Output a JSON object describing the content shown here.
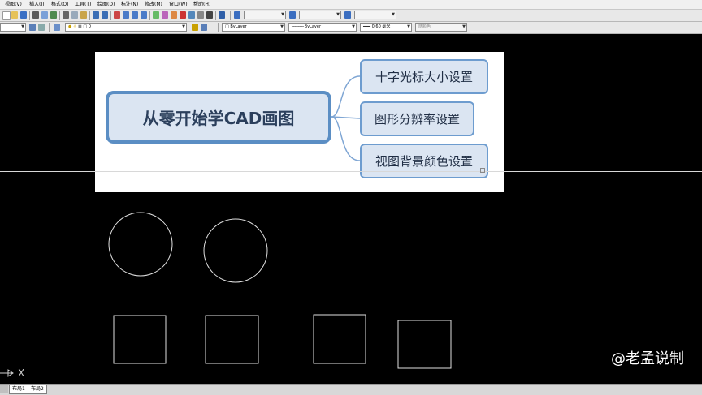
{
  "menubar": {
    "items": [
      "视图(V)",
      "插入(I)",
      "格式(O)",
      "工具(T)",
      "绘图(D)",
      "标注(N)",
      "修改(M)",
      "窗口(W)",
      "帮助(H)"
    ]
  },
  "toolbar": {
    "layer_value": "0",
    "color_value": "ByLayer",
    "linetype_value": "ByLayer",
    "lineweight_value": "0.60 毫米",
    "plotstyle_value": "随颜色"
  },
  "mindmap": {
    "central": "从零开始学CAD画图",
    "branches": [
      "十字光标大小设置",
      "图形分辨率设置",
      "视图背景颜色设置"
    ],
    "colors": {
      "fill": "#dbe5f2",
      "border": "#5b8ec4",
      "connector": "#7fa6d4"
    }
  },
  "canvas": {
    "background": "#000000",
    "crosshair_color": "#d8d8d8",
    "ucs_label": "X"
  },
  "tabs": [
    "布局1",
    "布局2"
  ],
  "watermark": "@老孟说制"
}
